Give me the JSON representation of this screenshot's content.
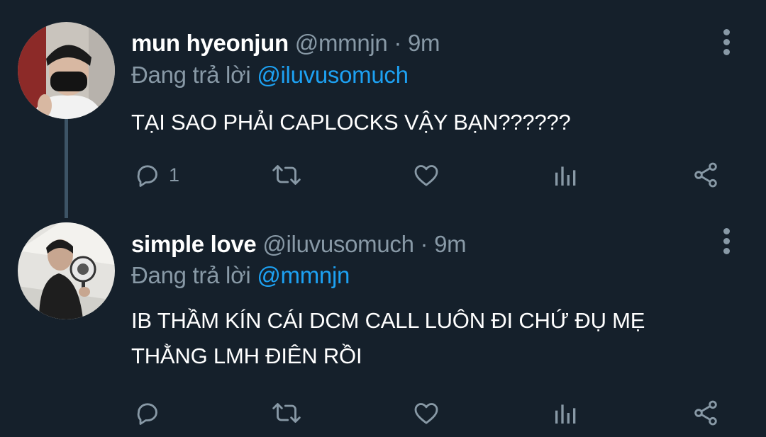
{
  "colors": {
    "background": "#15202b",
    "text_primary": "#ffffff",
    "text_secondary": "#8899a6",
    "link": "#1da1f2",
    "thread_line": "#3d5466"
  },
  "tweets": [
    {
      "display_name": "mun hyeonjun",
      "handle": "@mmnjn",
      "separator": "·",
      "time": "9m",
      "replying_prefix": "Đang trả lời",
      "replying_to": "@iluvusomuch",
      "text_lines": [
        "TẠI SAO PHẢI CAPLOCKS VẬY BẠN??????"
      ],
      "reply_count": "1",
      "avatar_icon": "profile-photo-mask"
    },
    {
      "display_name": "simple love",
      "handle": "@iluvusomuch",
      "separator": "·",
      "time": "9m",
      "replying_prefix": "Đang trả lời",
      "replying_to": "@mmnjn",
      "text_lines": [
        "IB THẦM KÍN CÁI DCM CALL LUÔN ĐI CHỨ ĐỤ MẸ",
        "THẰNG LMH ĐIÊN RỒI"
      ],
      "reply_count": "",
      "avatar_icon": "profile-photo-fan"
    }
  ],
  "action_icons": [
    "reply-icon",
    "retweet-icon",
    "like-icon",
    "analytics-icon",
    "share-icon"
  ]
}
